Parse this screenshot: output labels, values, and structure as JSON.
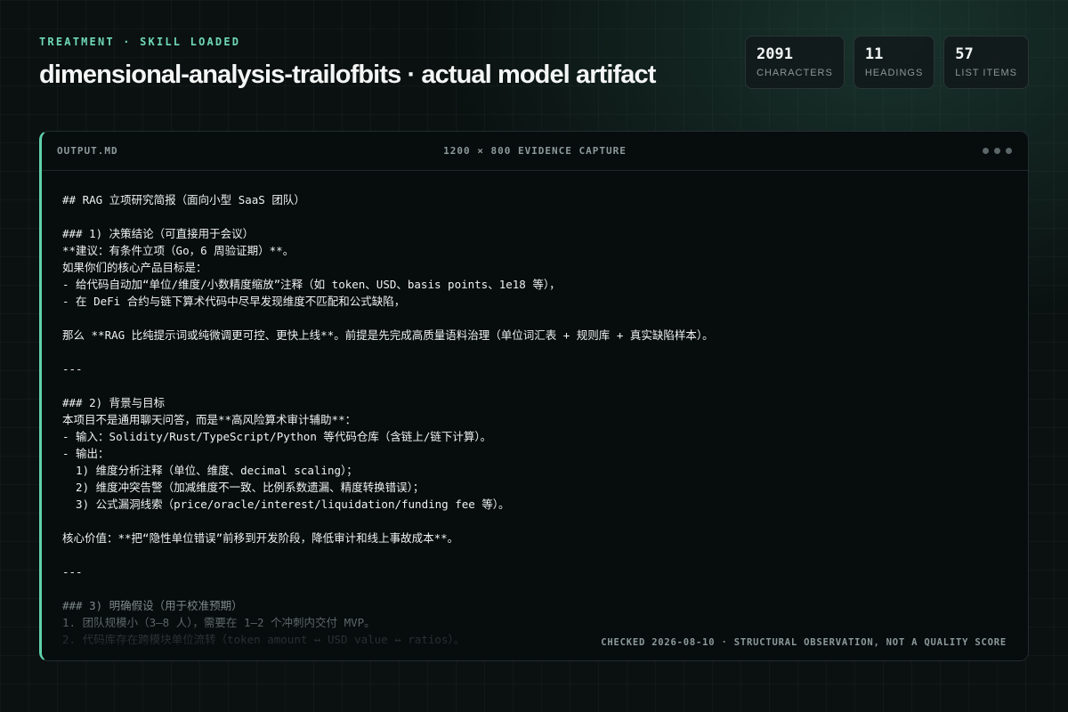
{
  "header": {
    "eyebrow": "TREATMENT · SKILL LOADED",
    "title": "dimensional-analysis-trailofbits · actual model artifact"
  },
  "stats": [
    {
      "value": "2091",
      "label": "CHARACTERS"
    },
    {
      "value": "11",
      "label": "HEADINGS"
    },
    {
      "value": "57",
      "label": "LIST ITEMS"
    }
  ],
  "panel": {
    "filename": "OUTPUT.MD",
    "caption": "1200 × 800 EVIDENCE CAPTURE",
    "footnote": "CHECKED 2026-08-10 · STRUCTURAL OBSERVATION, NOT A QUALITY SCORE",
    "lines": [
      "## RAG 立项研究简报（面向小型 SaaS 团队）",
      "",
      "### 1) 决策结论（可直接用于会议）",
      "**建议：有条件立项（Go，6 周验证期）**。",
      "如果你们的核心产品目标是：",
      "- 给代码自动加“单位/维度/小数精度缩放”注释（如 token、USD、basis points、1e18 等），",
      "- 在 DeFi 合约与链下算术代码中尽早发现维度不匹配和公式缺陷，",
      "",
      "那么 **RAG 比纯提示词或纯微调更可控、更快上线**。前提是先完成高质量语料治理（单位词汇表 + 规则库 + 真实缺陷样本）。",
      "",
      "---",
      "",
      "### 2) 背景与目标",
      "本项目不是通用聊天问答，而是**高风险算术审计辅助**：",
      "- 输入：Solidity/Rust/TypeScript/Python 等代码仓库（含链上/链下计算）。",
      "- 输出：",
      "  1) 维度分析注释（单位、维度、decimal scaling）；",
      "  2) 维度冲突告警（加减维度不一致、比例系数遗漏、精度转换错误）；",
      "  3) 公式漏洞线索（price/oracle/interest/liquidation/funding fee 等）。",
      "",
      "核心价值：**把“隐性单位错误”前移到开发阶段，降低审计和线上事故成本**。",
      "",
      "---",
      "",
      "### 3) 明确假设（用于校准预期）",
      "1. 团队规模小（3–8 人），需要在 1–2 个冲刺内交付 MVP。",
      "2. 代码库存在跨模块单位流转（token amount ↔ USD value ↔ ratios）。"
    ]
  }
}
